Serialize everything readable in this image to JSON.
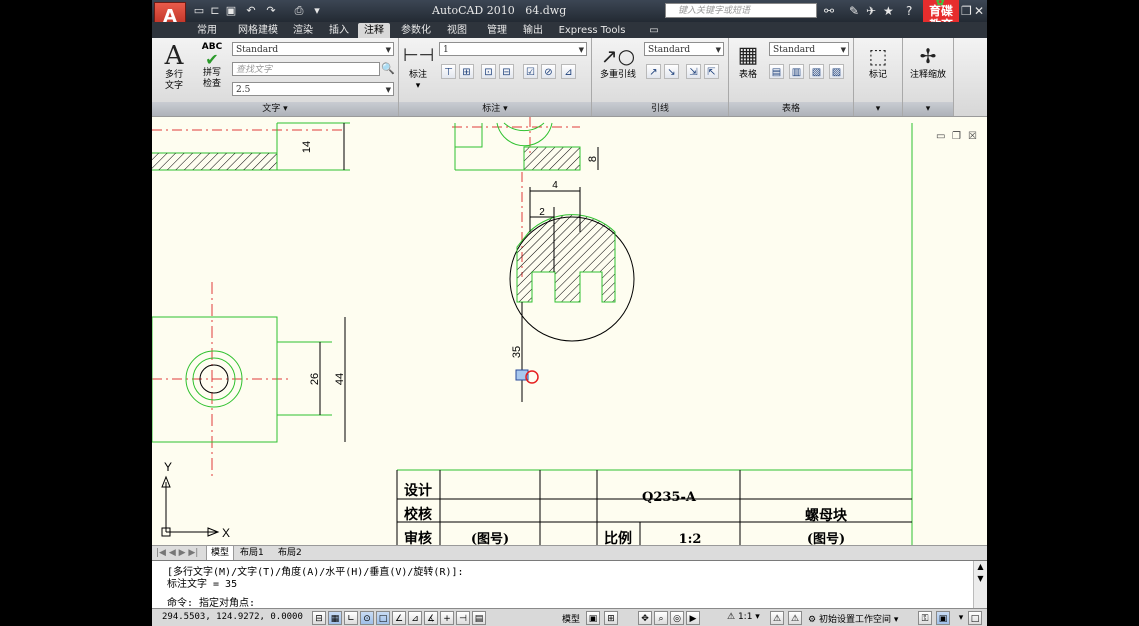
{
  "title": {
    "app": "AutoCAD 2010",
    "file": "64.dwg"
  },
  "search_placeholder": "键入关键字或短语",
  "badge": {
    "line1": "育碟",
    "line2": "教育"
  },
  "tabs": [
    "常用",
    "网格建模",
    "渲染",
    "插入",
    "注释",
    "参数化",
    "视图",
    "管理",
    "输出",
    "Express Tools"
  ],
  "active_tab": "注释",
  "ribbon": {
    "text_panel": {
      "title": "文字",
      "mtext_label1": "多行",
      "mtext_label2": "文字",
      "spell_label1": "拼写",
      "spell_label2": "检查",
      "spell_icon_text": "ABC",
      "style_combo": "Standard",
      "find_placeholder": "查找文字",
      "height_combo": "2.5"
    },
    "dim_panel": {
      "title": "标注",
      "dim_label": "标注",
      "combo": "1"
    },
    "leader_panel": {
      "title": "引线",
      "mleader_label": "多重引线",
      "combo": "Standard"
    },
    "table_panel": {
      "title": "表格",
      "table_label": "表格",
      "combo": "Standard"
    },
    "markup_panel": {
      "label": "标记"
    },
    "scale_panel": {
      "label": "注释缩放"
    }
  },
  "drawing": {
    "dims": {
      "d14": "14",
      "d8": "8",
      "d4": "4",
      "d2": "2",
      "d35": "35",
      "d26": "26",
      "d44": "44"
    },
    "axes": {
      "x": "X",
      "y": "Y"
    },
    "titleblock": {
      "design": "设计",
      "check": "校核",
      "review": "审核",
      "material": "Q235-A",
      "part_name": "螺母块",
      "drawing_no_left": "(图号)",
      "drawing_no_right": "(图号)",
      "scale_label": "比例",
      "scale_value": "1:2"
    }
  },
  "layout_tabs": [
    "模型",
    "布局1",
    "布局2"
  ],
  "command": {
    "line1": "[多行文字(M)/文字(T)/角度(A)/水平(H)/垂直(V)/旋转(R)]:",
    "line2": "标注文字 = 35",
    "prompt": "命令: 指定对角点:"
  },
  "status": {
    "coords": "294.5503, 124.9272, 0.0000",
    "model_label": "模型",
    "scale_label": "1:1",
    "workspace": "初始设置工作空间"
  }
}
